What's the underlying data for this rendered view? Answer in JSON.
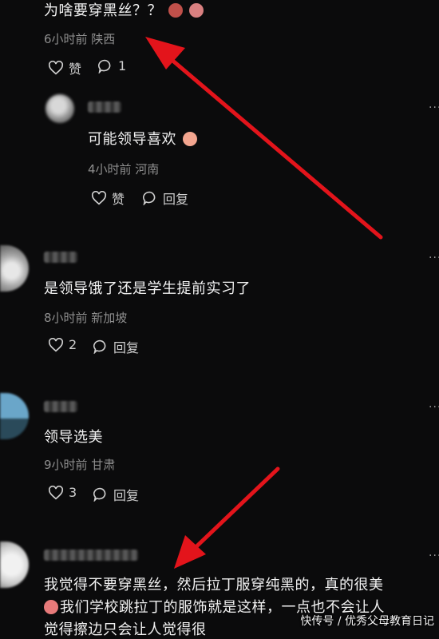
{
  "comments": [
    {
      "text": "为啥要穿黑丝？？",
      "meta": "6小时前 陕西",
      "like_label": "赞",
      "reply_count": "1"
    },
    {
      "text": "可能领导喜欢",
      "meta": "4小时前 河南",
      "like_label": "赞",
      "reply_label": "回复"
    },
    {
      "text": "是领导饿了还是学生提前实习了",
      "meta": "8小时前 新加坡",
      "like_count": "2",
      "reply_label": "回复"
    },
    {
      "text": "领导选美",
      "meta": "9小时前 甘肃",
      "like_count": "3",
      "reply_label": "回复"
    },
    {
      "line1": "我觉得不要穿黑丝，然后拉丁服穿纯黑的，真的很美",
      "line2": "我们学校跳拉丁的服饰就是这样，一点也不会让人",
      "line3": "觉得擦边只会让人觉得很"
    }
  ],
  "watermark": "快传号 / 优秀父母教育日记",
  "menu_icon": "more-dots-icon",
  "accent_color": "#e3141b"
}
